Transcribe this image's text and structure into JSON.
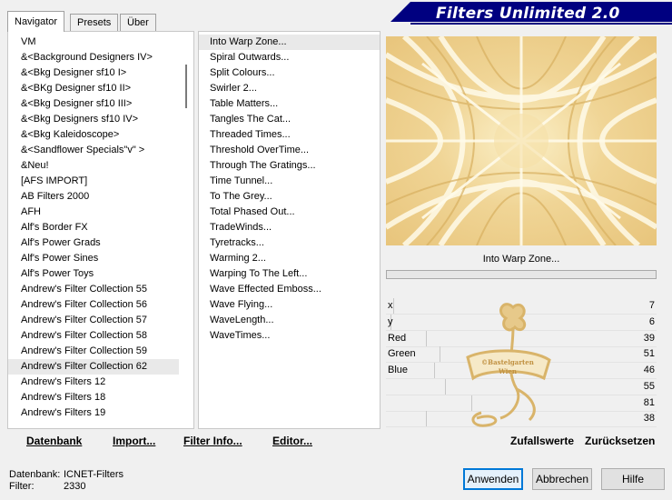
{
  "tabs": [
    "Navigator",
    "Presets",
    "Über"
  ],
  "active_tab": "Navigator",
  "banner": {
    "title": "Filters Unlimited 2.0"
  },
  "categories": [
    "VM",
    "&<Background Designers IV>",
    "&<Bkg Designer sf10 I>",
    "&<BKg Designer sf10 II>",
    "&<Bkg Designer sf10 III>",
    "&<Bkg Designers sf10 IV>",
    "&<Bkg Kaleidoscope>",
    "&<Sandflower Specials\"v\" >",
    "&Neu!",
    "[AFS IMPORT]",
    "AB Filters 2000",
    "AFH",
    "Alf's Border FX",
    "Alf's Power Grads",
    "Alf's Power Sines",
    "Alf's Power Toys",
    "Andrew's Filter Collection 55",
    "Andrew's Filter Collection 56",
    "Andrew's Filter Collection 57",
    "Andrew's Filter Collection 58",
    "Andrew's Filter Collection 59",
    "Andrew's Filter Collection 62",
    "Andrew's Filters 12",
    "Andrew's Filters 18",
    "Andrew's Filters 19"
  ],
  "selected_category": "Andrew's Filter Collection 62",
  "filters": [
    "Into Warp Zone...",
    "Spiral Outwards...",
    "Split Colours...",
    "Swirler 2...",
    "Table Matters...",
    "Tangles The Cat...",
    "Threaded Times...",
    "Threshold OverTime...",
    "Through The Gratings...",
    "Time Tunnel...",
    "To The Grey...",
    "Total Phased Out...",
    "TradeWinds...",
    "Tyretracks...",
    "Warming 2...",
    "Warping To The Left...",
    "Wave Effected Emboss...",
    "Wave Flying...",
    "WaveLength...",
    "WaveTimes..."
  ],
  "selected_filter": "Into Warp Zone...",
  "preview_caption": "Into Warp Zone...",
  "parameters": [
    {
      "label": "x",
      "value": "7",
      "level": 0.03
    },
    {
      "label": "y",
      "value": "6",
      "level": 0.02
    },
    {
      "label": "Red",
      "value": "39",
      "level": 0.15
    },
    {
      "label": "Green",
      "value": "51",
      "level": 0.2
    },
    {
      "label": "Blue",
      "value": "46",
      "level": 0.18
    },
    {
      "label": "",
      "value": "55",
      "level": 0.22
    },
    {
      "label": "",
      "value": "81",
      "level": 0.32
    },
    {
      "label": "",
      "value": "38",
      "level": 0.15
    }
  ],
  "watermark_text": [
    "©Bastelgarten",
    "Wien"
  ],
  "toolbar": {
    "database": "Datenbank",
    "import": "Import...",
    "filter_info": "Filter Info...",
    "editor": "Editor...",
    "random": "Zufallswerte",
    "reset": "Zurücksetzen"
  },
  "status": {
    "database_label": "Datenbank:",
    "database_value": "ICNET-Filters",
    "filter_label": "Filter:",
    "filter_value": "2330"
  },
  "buttons": {
    "apply": "Anwenden",
    "cancel": "Abbrechen",
    "help": "Hilfe"
  },
  "colors": {
    "banner": "#000080",
    "preview_base": "#f3dfa3",
    "watermark": "#d9b46a"
  }
}
